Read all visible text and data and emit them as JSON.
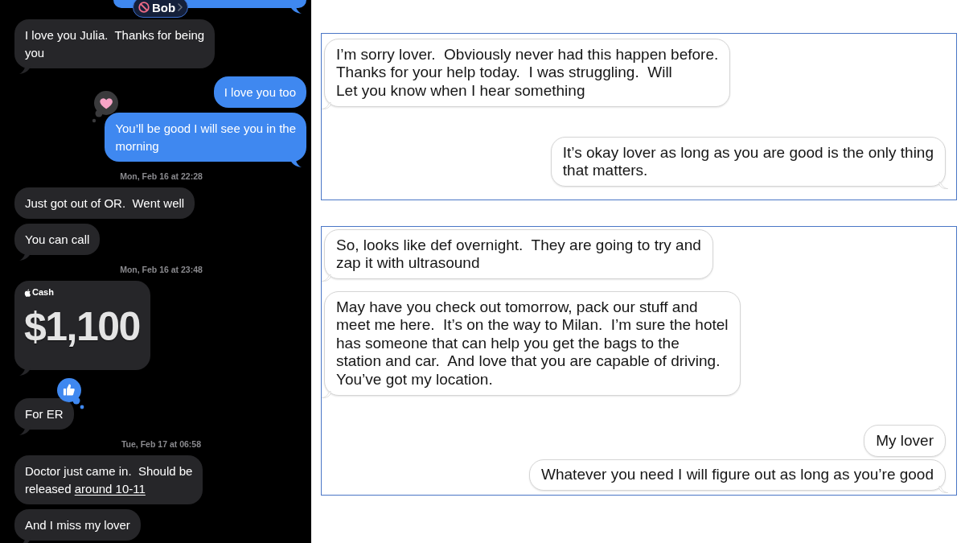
{
  "phone_chat": {
    "contact": {
      "name": "Bob"
    },
    "items": [
      {
        "kind": "cut_off",
        "outgoing": true,
        "tail": true
      },
      {
        "kind": "message",
        "outgoing": false,
        "text": "I love you Julia.  Thanks for being\nyou",
        "tail": true
      },
      {
        "kind": "message",
        "outgoing": true,
        "text": "I love you too",
        "tail": false
      },
      {
        "kind": "message",
        "outgoing": true,
        "text": "You’ll be good I will see you in the\nmorning",
        "tail": true,
        "reaction": {
          "kind": "heart"
        }
      },
      {
        "kind": "timestamp",
        "text": "Mon, Feb 16 at 22:28"
      },
      {
        "kind": "message",
        "outgoing": false,
        "text": "Just got out of OR.  Went well",
        "tail": false
      },
      {
        "kind": "message",
        "outgoing": false,
        "text": "You can call",
        "tail": true
      },
      {
        "kind": "timestamp",
        "text": "Mon, Feb 16 at 23:48"
      },
      {
        "kind": "payment",
        "outgoing": false,
        "label": "Cash",
        "amount": "$1,100",
        "tail": true
      },
      {
        "kind": "message",
        "outgoing": false,
        "text": "For ER",
        "tail": true,
        "reaction": {
          "kind": "thumbs_up"
        }
      },
      {
        "kind": "timestamp",
        "text": "Tue, Feb 17 at 06:58"
      },
      {
        "kind": "message",
        "outgoing": false,
        "text": "Doctor just came in.  Should be\nreleased ",
        "link": "around 10-11",
        "tail": false
      },
      {
        "kind": "message",
        "outgoing": false,
        "text": "And I miss my lover",
        "tail": true
      }
    ]
  },
  "message_panels": [
    {
      "messages": [
        {
          "outgoing": false,
          "text": "I’m sorry lover.  Obviously never had this happen before.\nThanks for your help today.  I was struggling.  Will\nLet you know when I hear something",
          "tail": true
        },
        {
          "outgoing": true,
          "text": "It’s okay lover as long as you are good is the only thing\nthat matters.",
          "tail": true
        }
      ]
    },
    {
      "messages": [
        {
          "outgoing": false,
          "text": "So, looks like def overnight.  They are going to try and\nzap it with ultrasound",
          "tail": true
        },
        {
          "outgoing": false,
          "text": "May have you check out tomorrow, pack our stuff and\nmeet me here.  It’s on the way to Milan.  I’m sure the hotel\nhas someone that can help you get the bags to the\nstation and car.  And love that you are capable of driving.\nYou’ve got my location.",
          "tail": true
        },
        {
          "outgoing": true,
          "text": "My lover",
          "tail": false
        },
        {
          "outgoing": true,
          "text": "Whatever you need I will figure out as long as you’re good",
          "tail": true
        }
      ]
    }
  ]
}
